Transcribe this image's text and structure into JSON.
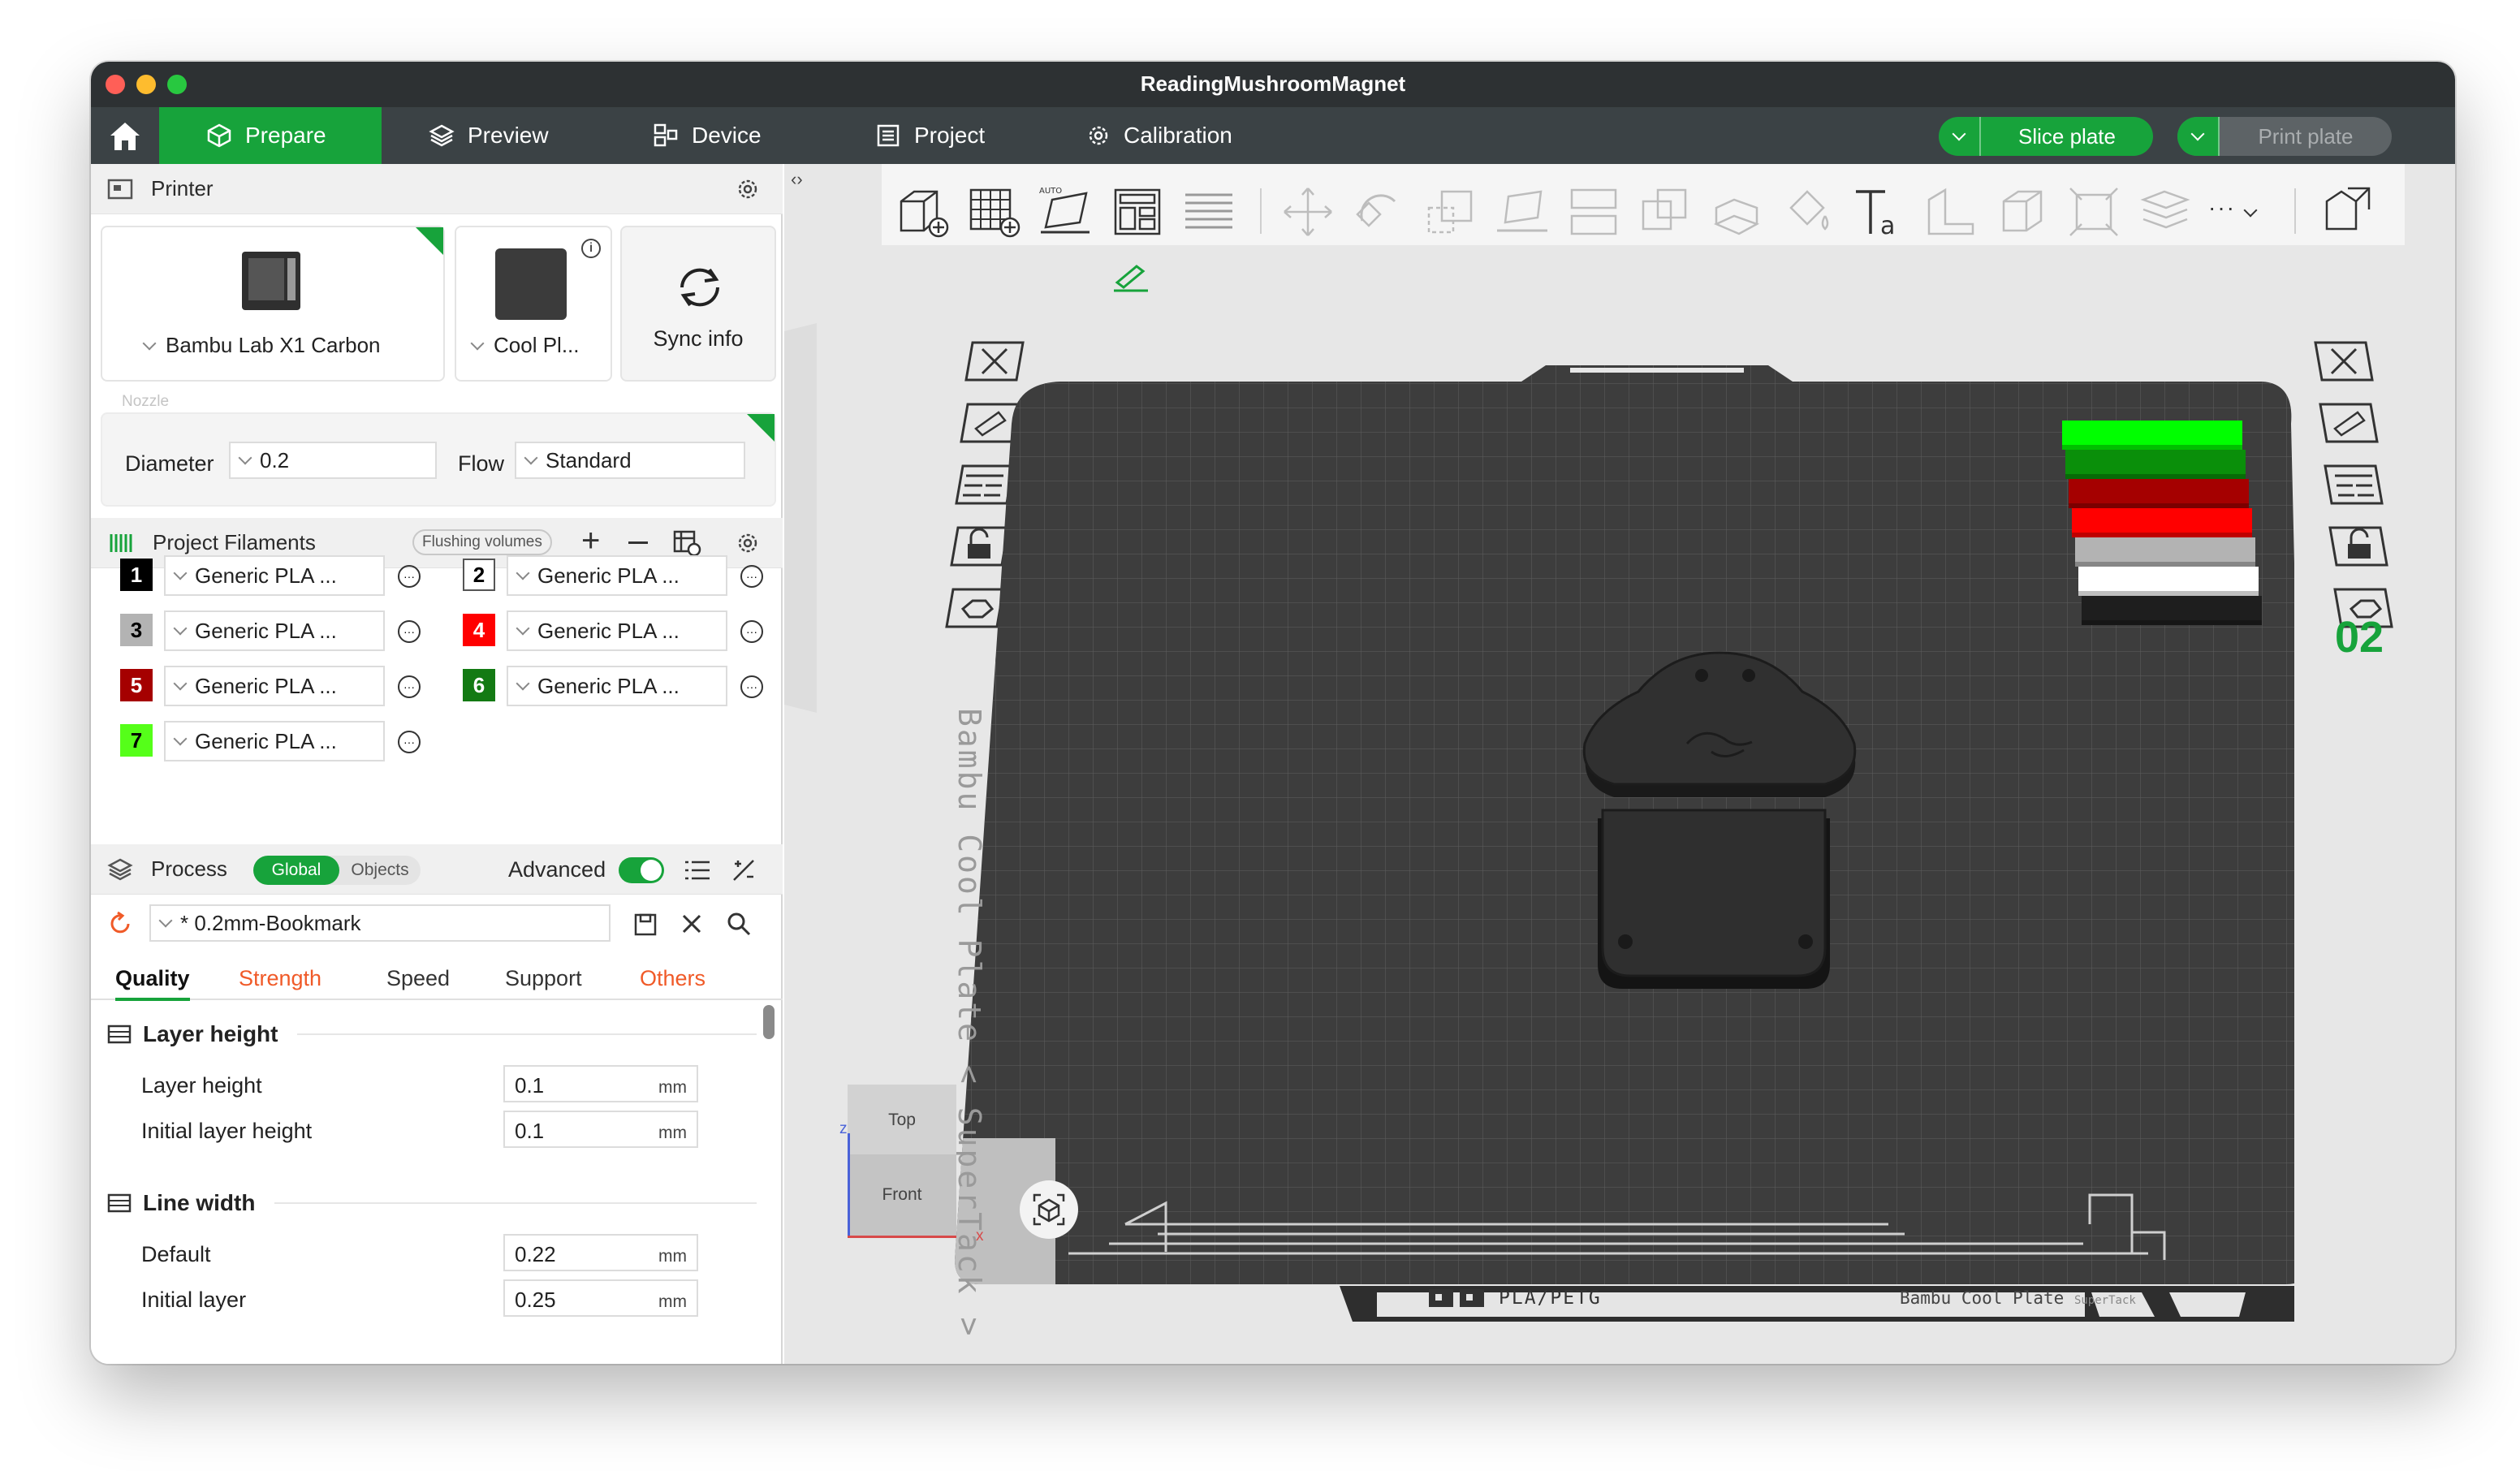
{
  "window": {
    "title": "ReadingMushroomMagnet"
  },
  "menu": {
    "tabs": [
      {
        "label": "Prepare"
      },
      {
        "label": "Preview"
      },
      {
        "label": "Device"
      },
      {
        "label": "Project"
      },
      {
        "label": "Calibration"
      }
    ],
    "slice_label": "Slice plate",
    "print_label": "Print plate"
  },
  "printer": {
    "section_title": "Printer",
    "printer_name": "Bambu Lab X1 Carbon",
    "plate_name": "Cool Pl...",
    "sync_label": "Sync info",
    "nozzle_label": "Nozzle",
    "diameter_label": "Diameter",
    "diameter_value": "0.2",
    "flow_label": "Flow",
    "flow_value": "Standard"
  },
  "filaments": {
    "section_title": "Project Filaments",
    "flushing_label": "Flushing volumes",
    "items": [
      {
        "num": "1",
        "name": "Generic PLA ...",
        "color": "#000000",
        "text": "#ffffff"
      },
      {
        "num": "2",
        "name": "Generic PLA ...",
        "color": "#ffffff",
        "text": "#000000"
      },
      {
        "num": "3",
        "name": "Generic PLA ...",
        "color": "#b3b3b3",
        "text": "#000000"
      },
      {
        "num": "4",
        "name": "Generic PLA ...",
        "color": "#ff0000",
        "text": "#ffffff"
      },
      {
        "num": "5",
        "name": "Generic PLA ...",
        "color": "#a50000",
        "text": "#ffffff"
      },
      {
        "num": "6",
        "name": "Generic PLA ...",
        "color": "#137a13",
        "text": "#ffffff"
      },
      {
        "num": "7",
        "name": "Generic PLA ...",
        "color": "#55ff19",
        "text": "#000000"
      }
    ]
  },
  "process": {
    "section_title": "Process",
    "global_label": "Global",
    "objects_label": "Objects",
    "advanced_label": "Advanced",
    "advanced_on": true,
    "preset": "* 0.2mm-Bookmark",
    "tabs": [
      {
        "label": "Quality",
        "state": "active"
      },
      {
        "label": "Strength",
        "state": "modified"
      },
      {
        "label": "Speed",
        "state": "normal"
      },
      {
        "label": "Support",
        "state": "normal"
      },
      {
        "label": "Others",
        "state": "modified"
      }
    ],
    "groups": [
      {
        "title": "Layer height",
        "rows": [
          {
            "label": "Layer height",
            "value": "0.1",
            "unit": "mm"
          },
          {
            "label": "Initial layer height",
            "value": "0.1",
            "unit": "mm"
          }
        ]
      },
      {
        "title": "Line width",
        "rows": [
          {
            "label": "Default",
            "value": "0.22",
            "unit": "mm"
          },
          {
            "label": "Initial layer",
            "value": "0.25",
            "unit": "mm"
          }
        ]
      }
    ]
  },
  "plate": {
    "bed_label": "Bambu Cool Plate",
    "bed_sub": "SuperTack",
    "bed_material": "PLA/PETG",
    "plate_number": "02",
    "view_top": "Top",
    "view_front": "Front",
    "axis_x": "x",
    "axis_z": "z",
    "tower_colors": [
      "#00ff00",
      "#0a8f0a",
      "#a50000",
      "#ff0000",
      "#b3b3b3",
      "#ffffff",
      "#1e1e1e"
    ]
  },
  "colors": {
    "accent": "#17a33b",
    "titlebar": "#2d3133",
    "menubar": "#3b4245",
    "modified_tab": "#f05a28",
    "bed": "#3d3d3d"
  }
}
